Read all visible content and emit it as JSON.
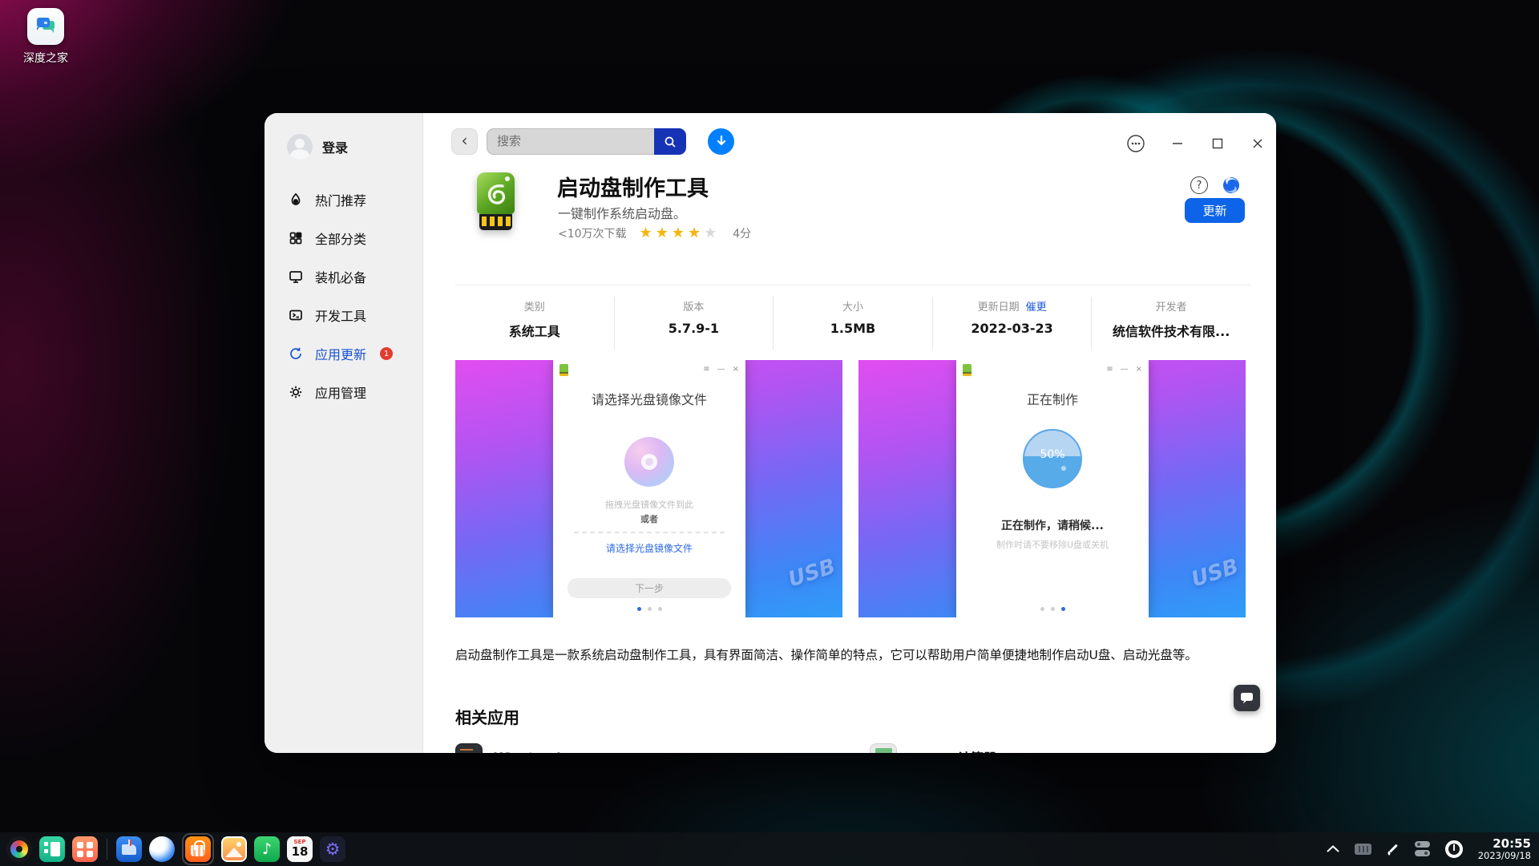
{
  "desktop": {
    "shortcut_label": "深度之家",
    "clock": {
      "time": "20:55",
      "date": "2023/09/18"
    },
    "calendar": {
      "month": "SEP",
      "day": "18"
    }
  },
  "sidebar": {
    "login_label": "登录",
    "items": [
      {
        "label": "热门推荐"
      },
      {
        "label": "全部分类"
      },
      {
        "label": "装机必备"
      },
      {
        "label": "开发工具"
      },
      {
        "label": "应用更新",
        "badge": "1"
      },
      {
        "label": "应用管理"
      }
    ]
  },
  "topbar": {
    "search_placeholder": "搜索"
  },
  "app": {
    "title": "启动盘制作工具",
    "subtitle": "一键制作系统启动盘。",
    "downloads": "<10万次下载",
    "score": "4分",
    "update_button": "更新"
  },
  "info": {
    "cols": [
      {
        "label": "类别",
        "value": "系统工具"
      },
      {
        "label": "版本",
        "value": "5.7.9-1"
      },
      {
        "label": "大小",
        "value": "1.5MB"
      },
      {
        "label": "更新日期",
        "link": "催更",
        "value": "2022-03-23"
      },
      {
        "label": "开发者",
        "value": "统信软件技术有限..."
      }
    ]
  },
  "screens": {
    "dialog_menu": "≡",
    "dialog_min": "—",
    "dialog_close": "×",
    "usb_decor": "USB",
    "first": {
      "title": "请选择光盘镜像文件",
      "drag_hint": "拖拽光盘镜像文件到此",
      "or_text": "或者",
      "choose_link": "请选择光盘镜像文件",
      "next_button": "下一步"
    },
    "second": {
      "title": "正在制作",
      "progress": "50%",
      "status": "正在制作，请稍候...",
      "hint": "制作时请不要移除U盘或关机"
    }
  },
  "glyphs": {
    "back": "‹",
    "question": "?",
    "star": "★",
    "music_note": "♪",
    "gear": "⚙"
  },
  "description": "启动盘制作工具是一款系统启动盘制作工具，具有界面简洁、操作简单的特点，它可以帮助用户简单便捷地制作启动U盘、启动光盘等。",
  "related": {
    "heading": "相关应用",
    "items": [
      {
        "name": "KSystemLog"
      },
      {
        "name": "Gnome计算器"
      }
    ]
  }
}
